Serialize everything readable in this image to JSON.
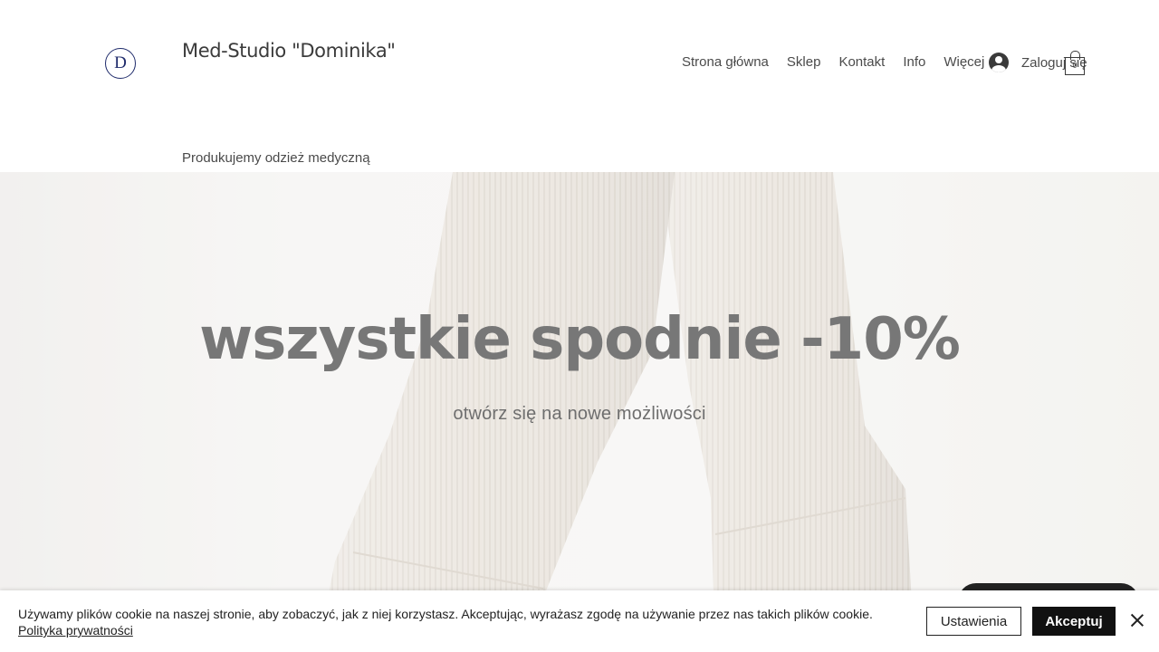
{
  "header": {
    "logo_letter": "D",
    "site_title": "Med-Studio \"Dominika\"",
    "tagline": "Produkujemy odzież medyczną"
  },
  "nav": {
    "items": [
      "Strona główna",
      "Sklep",
      "Kontakt",
      "Info",
      "Więcej"
    ],
    "login_label": "Zaloguj się",
    "login_icon": "user-avatar-icon",
    "cart_icon": "shopping-bag-icon",
    "cart_count": "0"
  },
  "hero": {
    "heading": "wszystkie spodnie -10%",
    "subheading": "otwórz się na nowe możliwości",
    "image": "model wearing light corduroy trousers"
  },
  "cookie_banner": {
    "text": "Używamy plików cookie na naszej stronie, aby zobaczyć, jak z niej korzystasz. Akceptując, wyrażasz zgodę na używanie przez nas takich plików cookie.",
    "privacy_link": "Polityka prywatności",
    "settings_label": "Ustawienia",
    "accept_label": "Akceptuj",
    "close_icon": "close-icon"
  },
  "colors": {
    "logo": "#1f2b6b",
    "accept_button": "#111111",
    "hero_text": "#777777"
  }
}
